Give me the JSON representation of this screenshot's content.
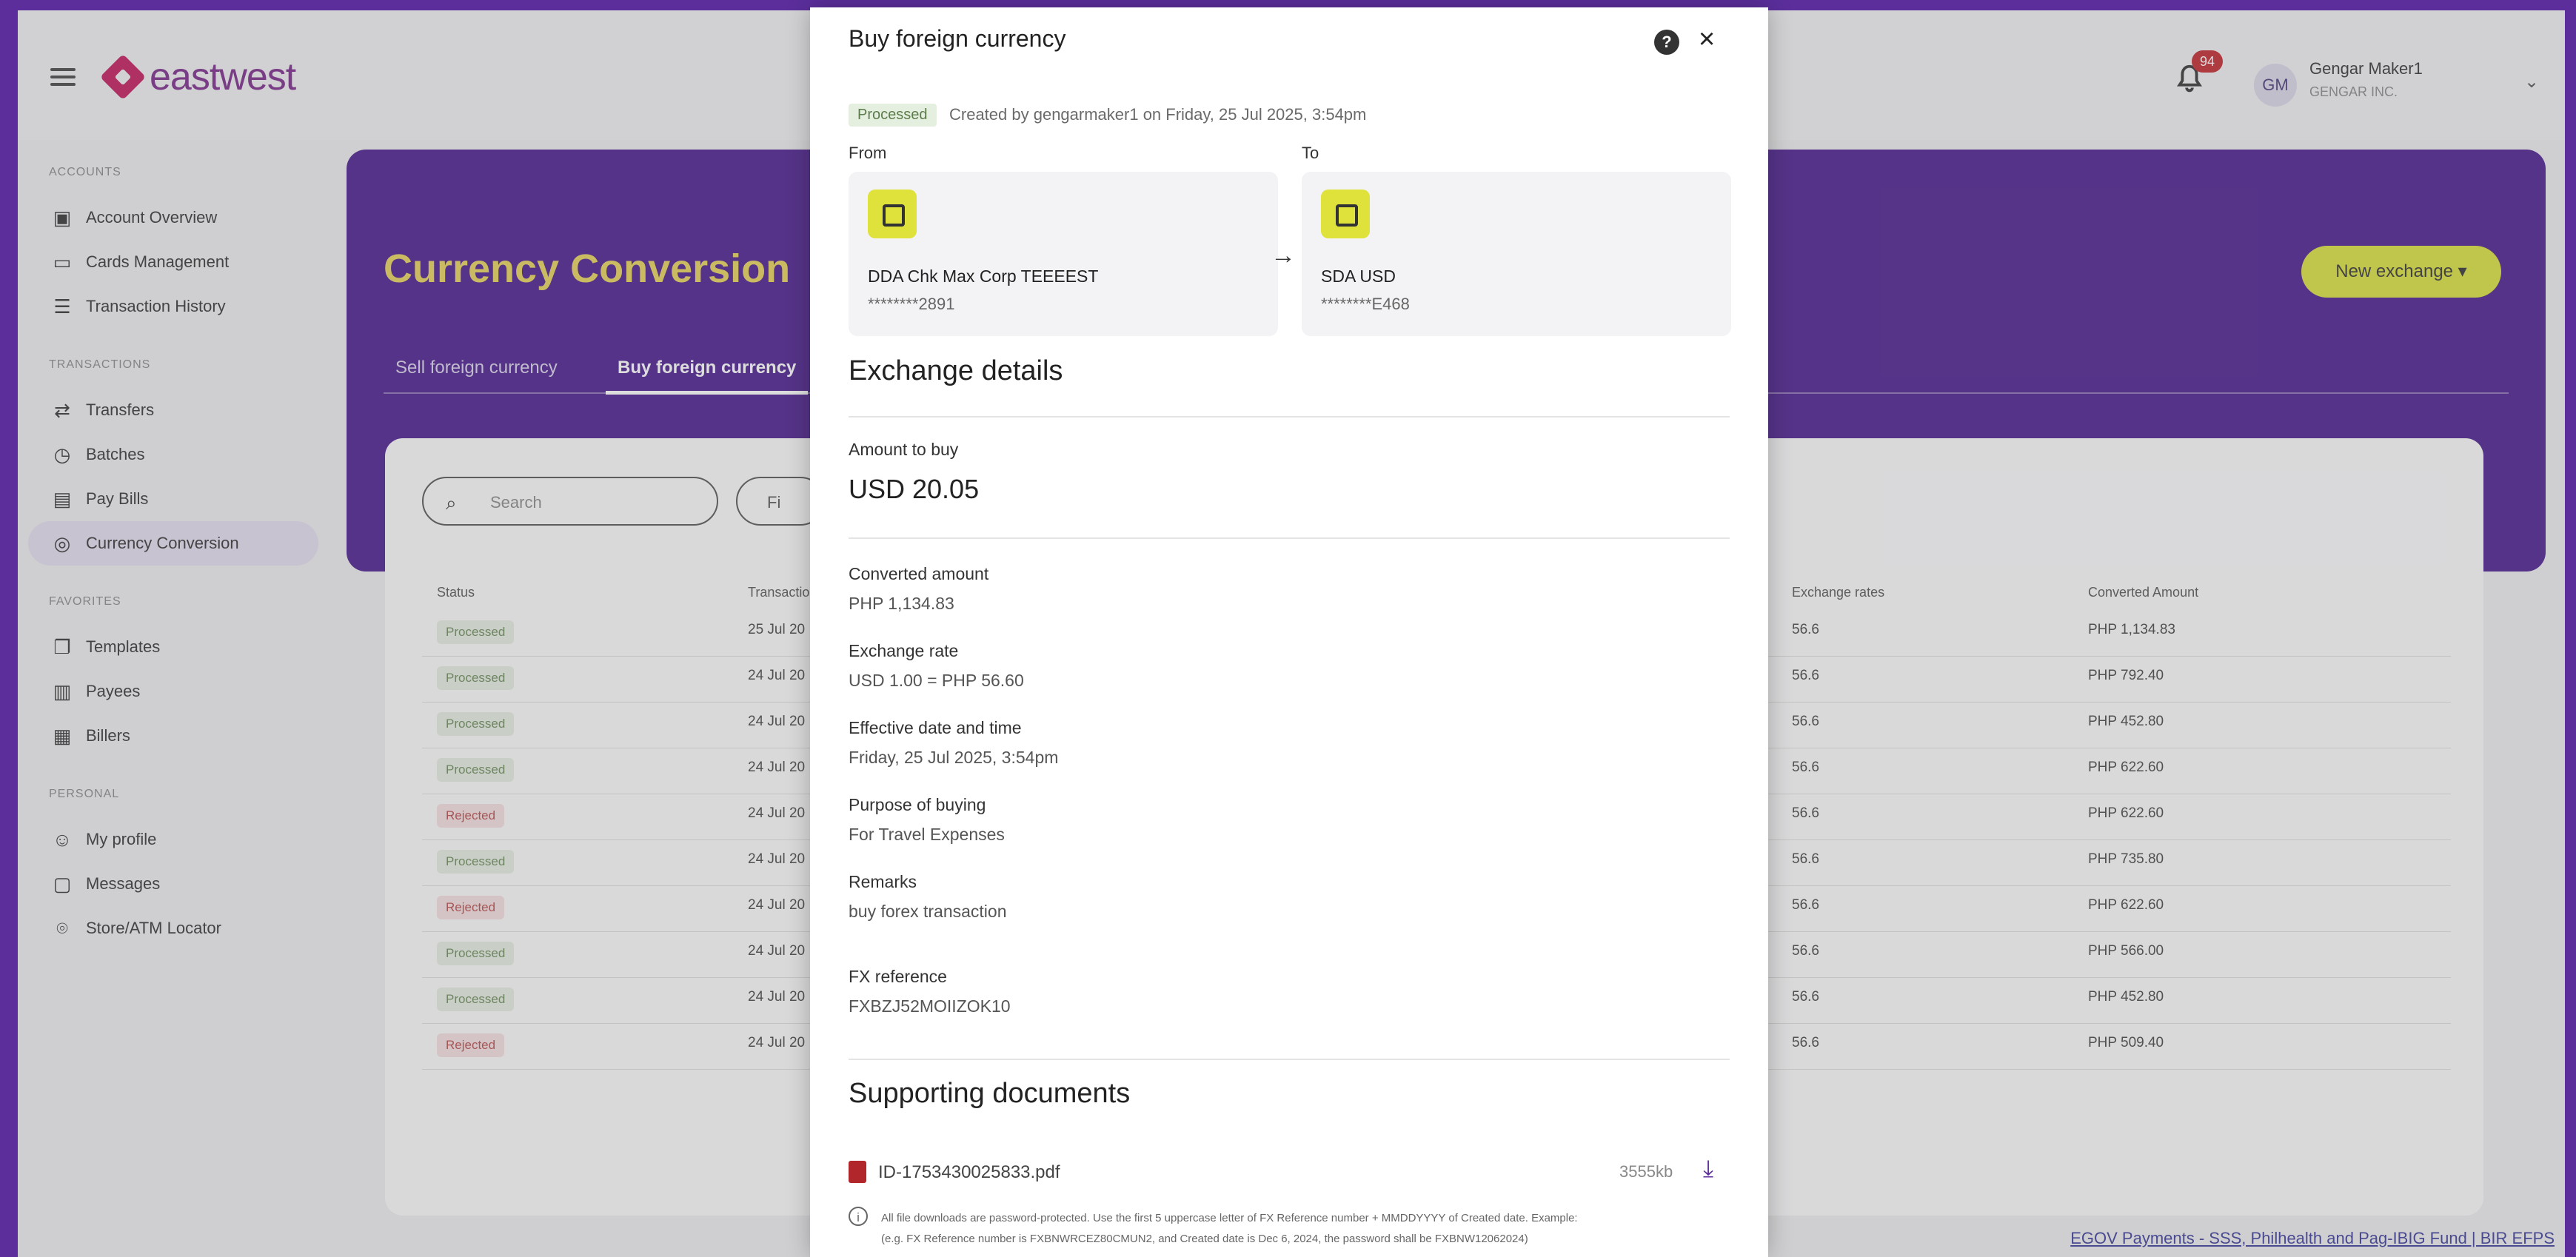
{
  "header": {
    "brand": "eastwest",
    "notification_count": "94",
    "avatar_initials": "GM",
    "user_name": "Gengar Maker1",
    "user_org": "GENGAR INC."
  },
  "sidebar": {
    "sections": [
      {
        "title": "ACCOUNTS",
        "items": [
          {
            "label": "Account Overview",
            "icon": "wallet-icon"
          },
          {
            "label": "Cards Management",
            "icon": "card-icon"
          },
          {
            "label": "Transaction History",
            "icon": "list-icon"
          }
        ]
      },
      {
        "title": "TRANSACTIONS",
        "items": [
          {
            "label": "Transfers",
            "icon": "transfer-icon"
          },
          {
            "label": "Batches",
            "icon": "clock-icon"
          },
          {
            "label": "Pay Bills",
            "icon": "bill-icon"
          },
          {
            "label": "Currency Conversion",
            "icon": "currency-icon",
            "active": true
          }
        ]
      },
      {
        "title": "FAVORITES",
        "items": [
          {
            "label": "Templates",
            "icon": "copy-icon"
          },
          {
            "label": "Payees",
            "icon": "contact-icon"
          },
          {
            "label": "Billers",
            "icon": "building-icon"
          }
        ]
      },
      {
        "title": "PERSONAL",
        "items": [
          {
            "label": "My profile",
            "icon": "user-icon"
          },
          {
            "label": "Messages",
            "icon": "message-icon"
          },
          {
            "label": "Store/ATM Locator",
            "icon": "location-icon"
          }
        ]
      }
    ]
  },
  "page": {
    "title": "Currency Conversion",
    "tabs": [
      "Sell foreign currency",
      "Buy foreign currency"
    ],
    "new_exchange": "New exchange ▾",
    "search_placeholder": "Search",
    "filter_label": "Fi",
    "columns": [
      "Status",
      "Transaction",
      "Exchange rates",
      "Converted Amount"
    ],
    "rows": [
      {
        "status": "Processed",
        "kind": "ok",
        "date": "25 Jul 20",
        "rate": "56.6",
        "amount": "PHP 1,134.83"
      },
      {
        "status": "Processed",
        "kind": "ok",
        "date": "24 Jul 20",
        "rate": "56.6",
        "amount": "PHP 792.40"
      },
      {
        "status": "Processed",
        "kind": "ok",
        "date": "24 Jul 20",
        "rate": "56.6",
        "amount": "PHP 452.80"
      },
      {
        "status": "Processed",
        "kind": "ok",
        "date": "24 Jul 20",
        "rate": "56.6",
        "amount": "PHP 622.60"
      },
      {
        "status": "Rejected",
        "kind": "bad",
        "date": "24 Jul 20",
        "rate": "56.6",
        "amount": "PHP 622.60"
      },
      {
        "status": "Processed",
        "kind": "ok",
        "date": "24 Jul 20",
        "rate": "56.6",
        "amount": "PHP 735.80"
      },
      {
        "status": "Rejected",
        "kind": "bad",
        "date": "24 Jul 20",
        "rate": "56.6",
        "amount": "PHP 622.60"
      },
      {
        "status": "Processed",
        "kind": "ok",
        "date": "24 Jul 20",
        "rate": "56.6",
        "amount": "PHP 566.00"
      },
      {
        "status": "Processed",
        "kind": "ok",
        "date": "24 Jul 20",
        "rate": "56.6",
        "amount": "PHP 452.80"
      },
      {
        "status": "Rejected",
        "kind": "bad",
        "date": "24 Jul 20",
        "rate": "56.6",
        "amount": "PHP 509.40"
      }
    ],
    "footer_links": "EGOV Payments - SSS, Philhealth and Pag-IBIG Fund | BIR EFPS"
  },
  "modal": {
    "title": "Buy foreign currency",
    "status": "Processed",
    "created": "Created by gengarmaker1 on Friday, 25 Jul 2025, 3:54pm",
    "from_label": "From",
    "to_label": "To",
    "from_name": "DDA Chk Max Corp TEEEEST",
    "from_number": "********2891",
    "to_name": "SDA USD",
    "to_number": "********E468",
    "exchange_heading": "Exchange details",
    "amount_label": "Amount to buy",
    "amount_value": "USD 20.05",
    "converted_label": "Converted amount",
    "converted_value": "PHP 1,134.83",
    "rate_label": "Exchange rate",
    "rate_value": "USD 1.00 = PHP 56.60",
    "effective_label": "Effective date and time",
    "effective_value": "Friday, 25 Jul 2025, 3:54pm",
    "purpose_label": "Purpose of buying",
    "purpose_value": "For Travel Expenses",
    "remarks_label": "Remarks",
    "remarks_value": "buy forex transaction",
    "fxref_label": "FX reference",
    "fxref_value": "FXBZJ52MOIIZOK10",
    "docs_heading": "Supporting documents",
    "doc_name": "ID-1753430025833.pdf",
    "doc_size": "3555kb",
    "note_line1": "All file downloads are password-protected. Use the first 5 uppercase letter of FX Reference number + MMDDYYYY of Created date. Example:",
    "note_line2": "(e.g. FX Reference number is FXBNWRCEZ80CMUN2, and Created date is Dec 6, 2024, the password shall be FXBNW12062024)"
  }
}
